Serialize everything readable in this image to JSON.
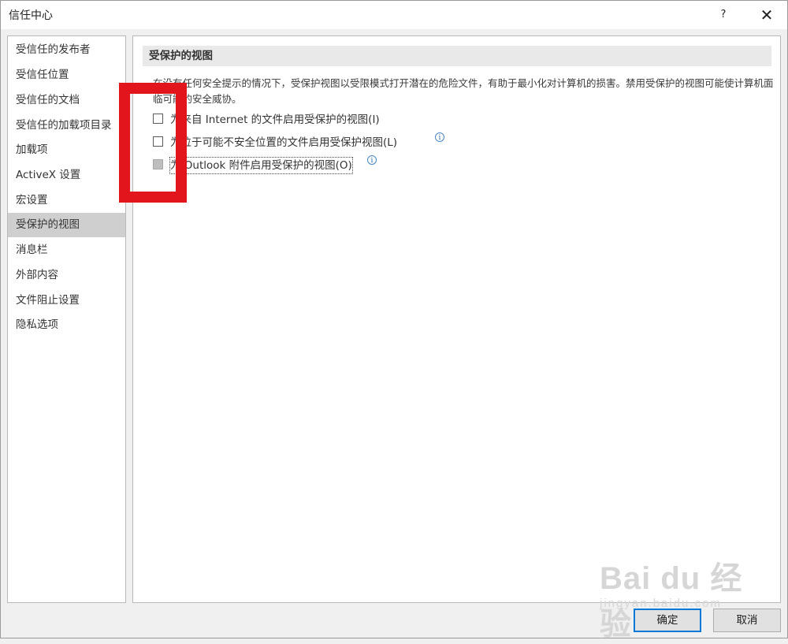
{
  "window": {
    "title": "信任中心",
    "help_label": "?",
    "close_label": "✕"
  },
  "sidebar": {
    "items": [
      {
        "label": "受信任的发布者"
      },
      {
        "label": "受信任位置"
      },
      {
        "label": "受信任的文档"
      },
      {
        "label": "受信任的加载项目录"
      },
      {
        "label": "加载项"
      },
      {
        "label": "ActiveX 设置"
      },
      {
        "label": "宏设置"
      },
      {
        "label": "受保护的视图",
        "selected": true
      },
      {
        "label": "消息栏"
      },
      {
        "label": "外部内容"
      },
      {
        "label": "文件阻止设置"
      },
      {
        "label": "隐私选项"
      }
    ]
  },
  "main": {
    "section_title": "受保护的视图",
    "description": "在没有任何安全提示的情况下，受保护视图以受限模式打开潜在的危险文件，有助于最小化对计算机的损害。禁用受保护的视图可能使计算机面临可能的安全威协。",
    "options": [
      {
        "label": "为来自 Internet 的文件启用受保护的视图(I)",
        "checked": false,
        "enabled": true,
        "info": false
      },
      {
        "label": "为位于可能不安全位置的文件启用受保护视图(L)",
        "checked": false,
        "enabled": true,
        "info": true
      },
      {
        "label": "为 Outlook 附件启用受保护的视图(O)",
        "checked": false,
        "enabled": false,
        "info": true
      }
    ],
    "info_glyph": "i"
  },
  "footer": {
    "ok_label": "确定",
    "cancel_label": "取消"
  },
  "watermark": {
    "logo": "Bai du 经验",
    "url": "jingyan.baidu.com"
  },
  "colors": {
    "annotation_red": "#e2141c",
    "selected_item": "#cfcfcf",
    "primary_border": "#0078d7"
  }
}
